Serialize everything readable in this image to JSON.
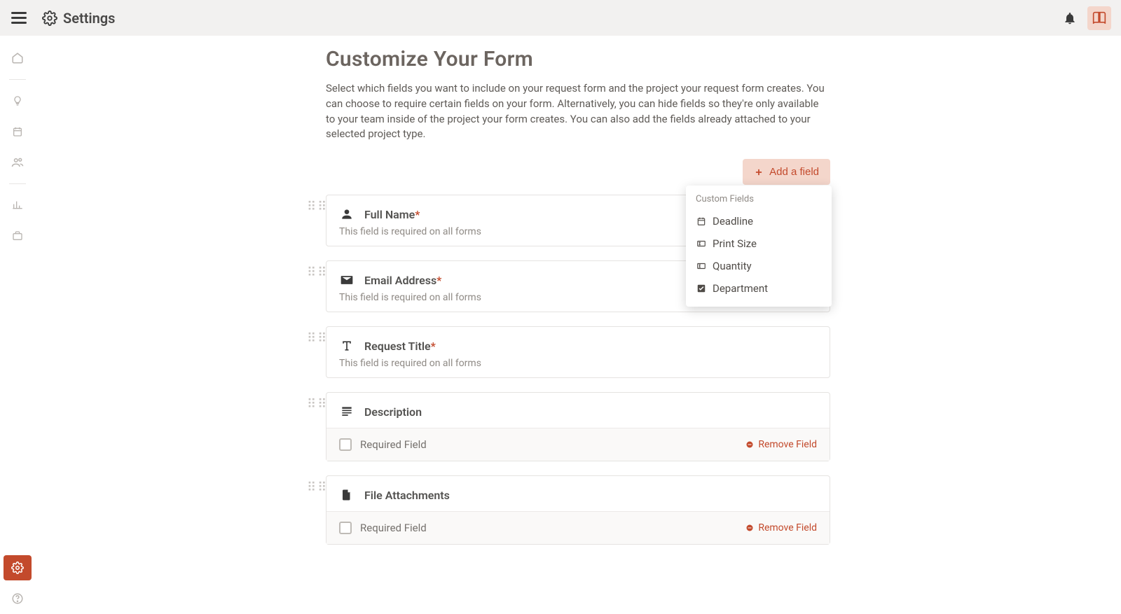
{
  "header": {
    "title": "Settings"
  },
  "main": {
    "heading": "Customize Your Form",
    "description": "Select which fields you want to include on your request form and the project your request form creates. You can choose to require certain fields on your form. Alternatively, you can hide fields so they're only available to your team inside of the project your form creates. You can also add the fields already attached to your selected project type.",
    "add_field_label": "Add a field"
  },
  "popover": {
    "title": "Custom Fields",
    "items": [
      {
        "label": "Deadline",
        "icon": "calendar"
      },
      {
        "label": "Print Size",
        "icon": "textbox"
      },
      {
        "label": "Quantity",
        "icon": "textbox"
      },
      {
        "label": "Department",
        "icon": "checkbox"
      }
    ]
  },
  "fields": [
    {
      "title": "Full Name",
      "required": true,
      "sub": "This field is required on all forms",
      "icon": "person",
      "footer": false
    },
    {
      "title": "Email Address",
      "required": true,
      "sub": "This field is required on all forms",
      "icon": "mail",
      "footer": false
    },
    {
      "title": "Request Title",
      "required": true,
      "sub": "This field is required on all forms",
      "icon": "text-t",
      "footer": false
    },
    {
      "title": "Description",
      "required": false,
      "sub": "",
      "icon": "description",
      "footer": true
    },
    {
      "title": "File Attachments",
      "required": false,
      "sub": "",
      "icon": "file",
      "footer": true
    }
  ],
  "labels": {
    "required_field": "Required Field",
    "remove_field": "Remove Field"
  }
}
